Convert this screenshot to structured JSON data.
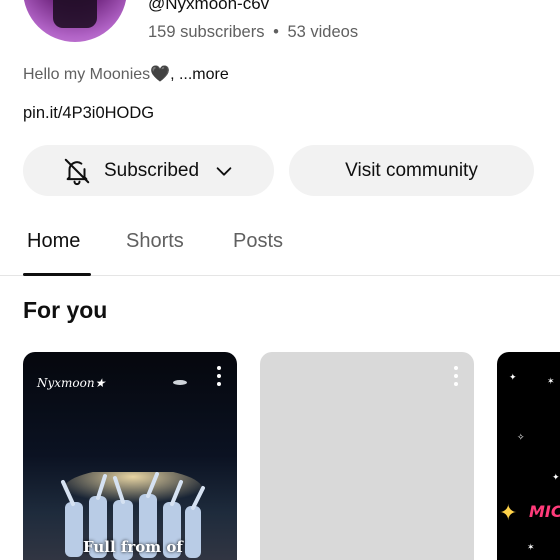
{
  "channel": {
    "handle": "@Nyxmoon-c6v",
    "subscribers": "159 subscribers",
    "separator": "•",
    "videos": "53 videos",
    "description": "Hello my Moonies",
    "description_emoji": "🖤",
    "description_more": ", ...more",
    "link": "pin.it/4P3i0HODG"
  },
  "actions": {
    "subscribed_label": "Subscribed",
    "visit_community_label": "Visit community"
  },
  "tabs": [
    {
      "label": "Home",
      "active": true
    },
    {
      "label": "Shorts",
      "active": false
    },
    {
      "label": "Posts",
      "active": false
    }
  ],
  "section": {
    "title": "For you"
  },
  "shorts": [
    {
      "logo": "Nyxmoon★",
      "caption": "Full from of"
    },
    {
      "placeholder": true
    },
    {
      "caption": "MIC"
    }
  ],
  "colors": {
    "pill_bg": "#f2f2f2",
    "secondary_text": "#606060",
    "primary_text": "#0f0f0f"
  }
}
